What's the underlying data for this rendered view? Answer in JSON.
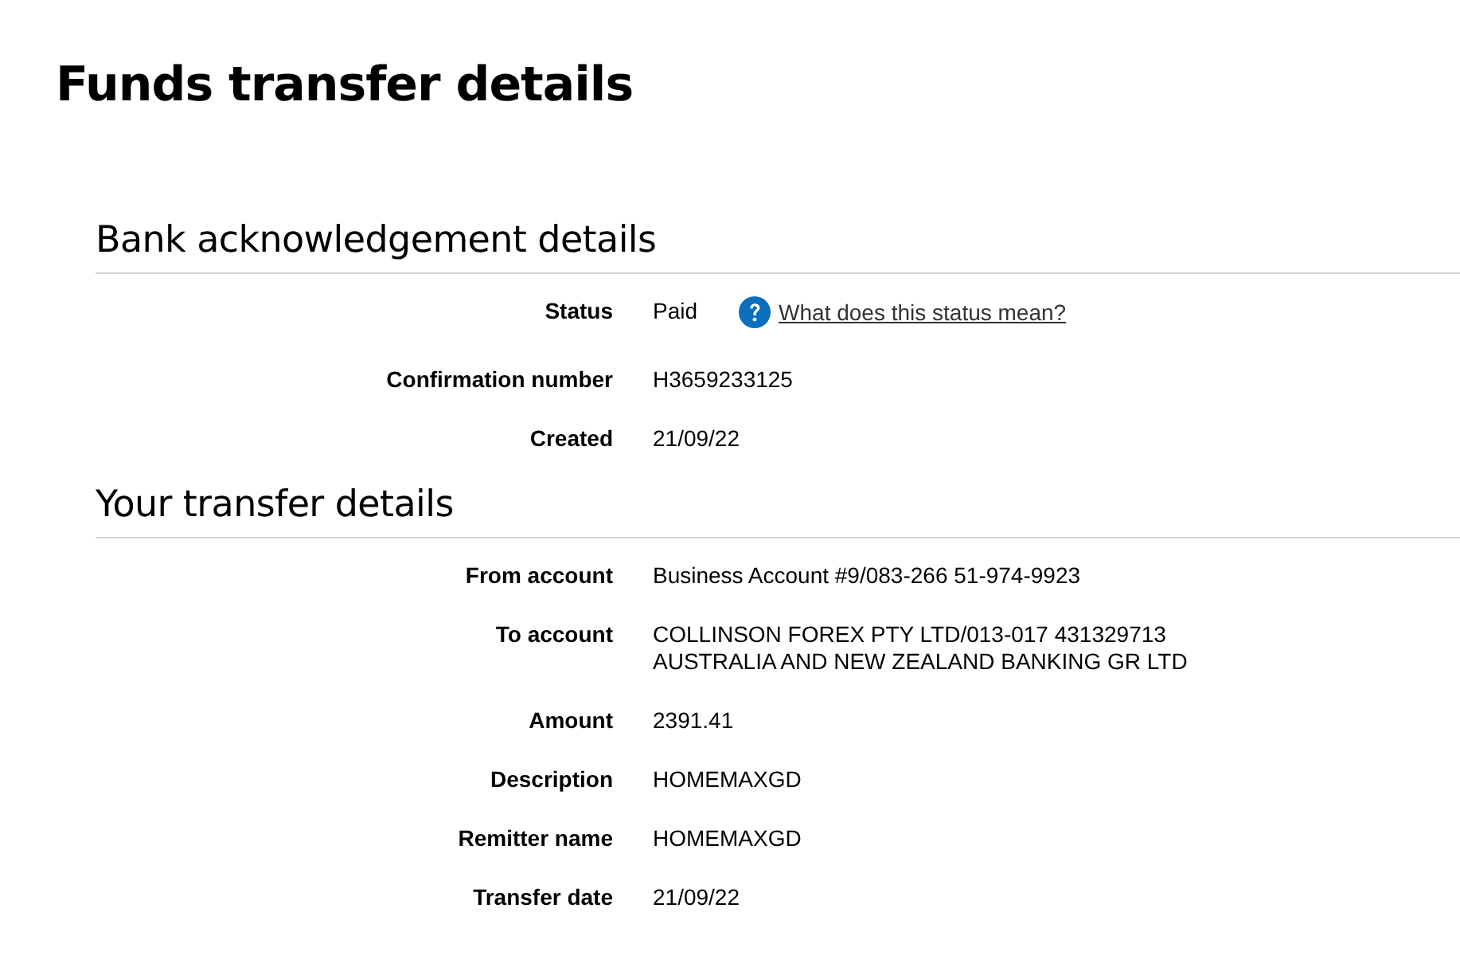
{
  "title": "Funds transfer details",
  "sections": [
    {
      "heading": "Bank acknowledgement details",
      "rows": [
        {
          "label": "Status",
          "lines": [
            "Paid"
          ],
          "help_link": "What does this status mean?"
        },
        {
          "label": "Confirmation number",
          "lines": [
            "H3659233125"
          ]
        },
        {
          "label": "Created",
          "lines": [
            "21/09/22"
          ]
        }
      ]
    },
    {
      "heading": "Your transfer details",
      "rows": [
        {
          "label": "From account",
          "lines": [
            "Business Account #9/083-266 51-974-9923"
          ]
        },
        {
          "label": "To account",
          "lines": [
            "COLLINSON FOREX PTY LTD/013-017 431329713",
            "AUSTRALIA AND NEW ZEALAND BANKING GR LTD"
          ]
        },
        {
          "label": "Amount",
          "lines": [
            "2391.41"
          ]
        },
        {
          "label": "Description",
          "lines": [
            "HOMEMAXGD"
          ]
        },
        {
          "label": "Remitter name",
          "lines": [
            "HOMEMAXGD"
          ]
        },
        {
          "label": "Transfer date",
          "lines": [
            "21/09/22"
          ]
        }
      ]
    }
  ]
}
